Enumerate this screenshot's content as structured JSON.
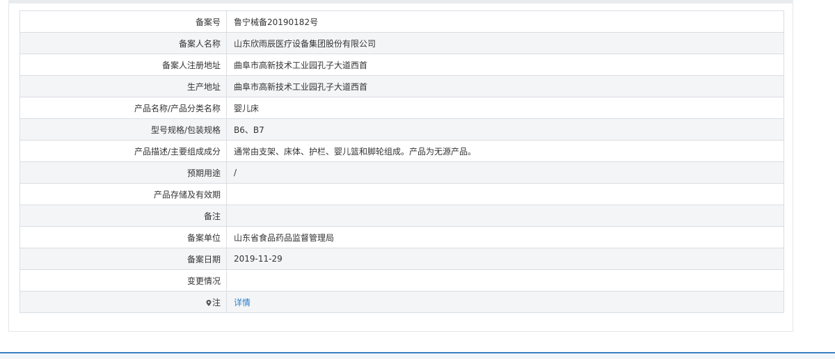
{
  "rows": [
    {
      "label": "备案号",
      "value": "鲁宁械备20190182号"
    },
    {
      "label": "备案人名称",
      "value": "山东欣雨辰医疗设备集团股份有限公司"
    },
    {
      "label": "备案人注册地址",
      "value": "曲阜市高新技术工业园孔子大道西首"
    },
    {
      "label": "生产地址",
      "value": "曲阜市高新技术工业园孔子大道西首"
    },
    {
      "label": "产品名称/产品分类名称",
      "value": "婴儿床"
    },
    {
      "label": "型号规格/包装规格",
      "value": "B6、B7"
    },
    {
      "label": "产品描述/主要组成成分",
      "value": "通常由支架、床体、护栏、婴儿篮和脚轮组成。产品为无源产品。"
    },
    {
      "label": "预期用途",
      "value": "/"
    },
    {
      "label": "产品存储及有效期",
      "value": ""
    },
    {
      "label": "备注",
      "value": ""
    },
    {
      "label": "备案单位",
      "value": "山东省食品药品监督管理局"
    },
    {
      "label": "备案日期",
      "value": "2019-11-29"
    },
    {
      "label": "变更情况",
      "value": ""
    }
  ],
  "note": {
    "label": "注",
    "link": "详情",
    "icon": "map-pin-icon"
  },
  "colors": {
    "link": "#2b7fc9",
    "border": "#d9dde2",
    "stripe": "#f4f5f7",
    "accent_bar": "#3c7fc0"
  }
}
